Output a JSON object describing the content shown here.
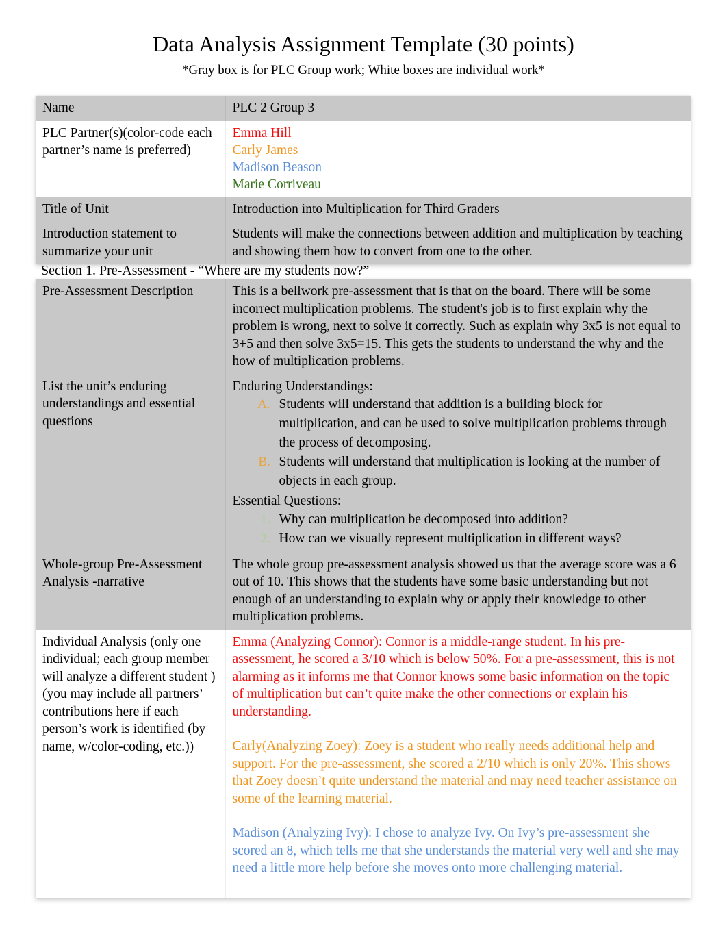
{
  "document": {
    "title": "Data Analysis Assignment Template (30 points)",
    "subtitle": "*Gray box is for PLC Group work; White boxes are individual work*"
  },
  "colors": {
    "emma_red": "#f30c0c",
    "carly_orange": "#f0951e",
    "madison_blue": "#5b8fd8",
    "marie_green": "#38761d",
    "alpha_marker": "#e8a33d",
    "numeric_marker": "#a5d18a",
    "gray_row": "#c8c8c8"
  },
  "info_table": {
    "rows": [
      {
        "label": "Name",
        "value": "PLC 2 Group 3",
        "shade": "gray"
      },
      {
        "label": "PLC Partner(s)(color-code each partner’s name is preferred)",
        "shade": "white",
        "partners": [
          {
            "name": "Emma Hill",
            "color": "#f30c0c"
          },
          {
            "name": "Carly James",
            "color": "#f0951e"
          },
          {
            "name": "Madison Beason",
            "color": "#5b8fd8"
          },
          {
            "name": "Marie Corriveau",
            "color": "#38761d"
          }
        ]
      },
      {
        "label": "Title of Unit",
        "value": "Introduction into Multiplication for Third Graders",
        "shade": "gray"
      },
      {
        "label": "Introduction statement to summarize your unit",
        "value": "Students will make the connections between addition and multiplication by teaching and showing them how to convert from one to the other.",
        "shade": "gray"
      }
    ]
  },
  "section1": {
    "heading": "Section 1. Pre-Assessment -  “Where are my students now?”",
    "pre_assessment_description": {
      "label": "Pre-Assessment Description",
      "value": "This is a bellwork pre-assessment that is that on the board.    There will be some incorrect multiplication problems. The student's job is to first explain why the problem is wrong, next to solve it correctly. Such as explain why 3x5 is not equal to 3+5 and then solve 3x5=15. This gets the students to understand the why and the how of multiplication problems."
    },
    "enduring": {
      "label": "List the unit’s enduring understandings and essential questions",
      "understandings_heading": "Enduring Understandings:",
      "understandings": [
        "Students will understand that addition is a building block for multiplication, and can be used to solve multiplication problems through the process of decomposing.",
        "Students will understand that multiplication is looking at the number of objects in each group."
      ],
      "questions_heading": "Essential Questions:",
      "questions": [
        "Why can multiplication be decomposed into addition?",
        "How can we visually represent multiplication in different ways?"
      ]
    },
    "whole_group": {
      "label": "Whole-group Pre-Assessment Analysis -narrative",
      "value": "The whole group pre-assessment analysis showed us that the average score was a 6 out of 10. This shows that the students have some basic understanding but not enough of an understanding to explain why or apply their knowledge to other multiplication problems."
    },
    "individual_analysis": {
      "label": "Individual Analysis (only one individual; each group member will analyze a different student  ) (you may include all partners’ contributions here if each person’s work is identified (by name, w/color-coding, etc.))",
      "entries": [
        {
          "author": "Emma",
          "color": "#f30c0c",
          "text": "Emma (Analyzing Connor): Connor is a middle-range student. In his pre-assessment, he scored a 3/10 which is below 50%. For a pre-assessment, this is not alarming as it informs me that Connor knows some basic information on the topic of multiplication but can’t quite make the other connections or explain his understanding."
        },
        {
          "author": "Carly",
          "color": "#f0951e",
          "text": "Carly(Analyzing Zoey): Zoey is a student who really needs additional help and support. For the pre-assessment, she scored a 2/10 which is only 20%. This shows that Zoey doesn’t quite understand the material and may need teacher assistance on some of the learning material."
        },
        {
          "author": "Madison",
          "color": "#5b8fd8",
          "text": "Madison  (Analyzing Ivy): I chose to analyze Ivy. On Ivy’s pre-assessment she scored an 8, which tells me that she understands the material very well and she may need a little more help before she moves onto more challenging material."
        }
      ]
    }
  }
}
